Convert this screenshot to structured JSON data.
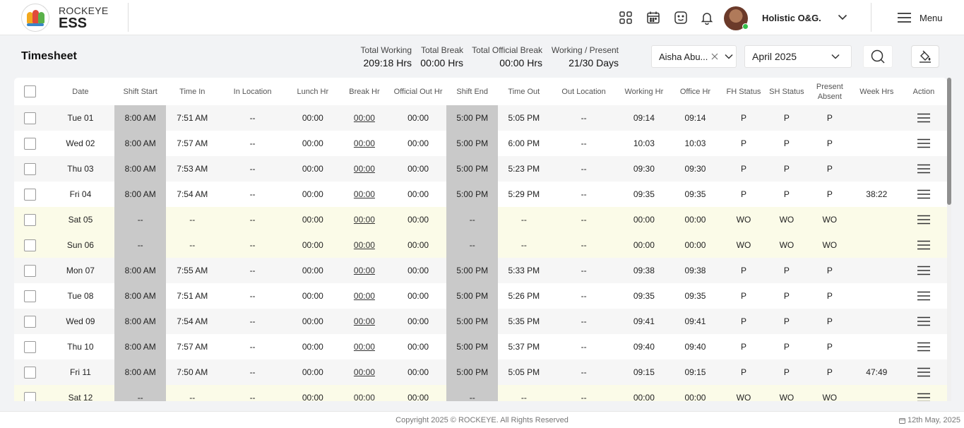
{
  "header": {
    "brand_top": "ROCKEYE",
    "brand_bottom": "ESS",
    "org_name": "Holistic O&G.",
    "menu_label": "Menu",
    "icons": [
      "apps-grid-icon",
      "calendar-icon",
      "chat-icon",
      "bell-icon"
    ]
  },
  "titlebar": {
    "title": "Timesheet",
    "stats": [
      {
        "label": "Total Working",
        "value": "209:18 Hrs"
      },
      {
        "label": "Total Break",
        "value": "00:00 Hrs"
      },
      {
        "label": "Total Official Break",
        "value": "00:00 Hrs"
      },
      {
        "label": "Working / Present",
        "value": "21/30 Days"
      }
    ],
    "employee": "Aisha Abu...",
    "month": "April 2025"
  },
  "table": {
    "headers": [
      "Date",
      "Shift Start",
      "Time In",
      "In Location",
      "Lunch Hr",
      "Break Hr",
      "Official Out Hr",
      "Shift End",
      "Time Out",
      "Out Location",
      "Working Hr",
      "Office Hr",
      "FH Status",
      "SH Status",
      "Present Absent",
      "Week Hrs",
      "Action"
    ],
    "rows": [
      {
        "date": "Tue 01",
        "shift_start": "8:00 AM",
        "time_in": "7:51 AM",
        "in_loc": "--",
        "lunch": "00:00",
        "brk": "00:00",
        "off_out": "00:00",
        "shift_end": "5:00 PM",
        "time_out": "5:05 PM",
        "out_loc": "--",
        "working": "09:14",
        "office": "09:14",
        "fh": "P",
        "sh": "P",
        "pa": "P",
        "week": "",
        "weekend": false
      },
      {
        "date": "Wed 02",
        "shift_start": "8:00 AM",
        "time_in": "7:57 AM",
        "in_loc": "--",
        "lunch": "00:00",
        "brk": "00:00",
        "off_out": "00:00",
        "shift_end": "5:00 PM",
        "time_out": "6:00 PM",
        "out_loc": "--",
        "working": "10:03",
        "office": "10:03",
        "fh": "P",
        "sh": "P",
        "pa": "P",
        "week": "",
        "weekend": false
      },
      {
        "date": "Thu 03",
        "shift_start": "8:00 AM",
        "time_in": "7:53 AM",
        "in_loc": "--",
        "lunch": "00:00",
        "brk": "00:00",
        "off_out": "00:00",
        "shift_end": "5:00 PM",
        "time_out": "5:23 PM",
        "out_loc": "--",
        "working": "09:30",
        "office": "09:30",
        "fh": "P",
        "sh": "P",
        "pa": "P",
        "week": "",
        "weekend": false
      },
      {
        "date": "Fri 04",
        "shift_start": "8:00 AM",
        "time_in": "7:54 AM",
        "in_loc": "--",
        "lunch": "00:00",
        "brk": "00:00",
        "off_out": "00:00",
        "shift_end": "5:00 PM",
        "time_out": "5:29 PM",
        "out_loc": "--",
        "working": "09:35",
        "office": "09:35",
        "fh": "P",
        "sh": "P",
        "pa": "P",
        "week": "38:22",
        "weekend": false
      },
      {
        "date": "Sat 05",
        "shift_start": "--",
        "time_in": "--",
        "in_loc": "--",
        "lunch": "00:00",
        "brk": "00:00",
        "off_out": "00:00",
        "shift_end": "--",
        "time_out": "--",
        "out_loc": "--",
        "working": "00:00",
        "office": "00:00",
        "fh": "WO",
        "sh": "WO",
        "pa": "WO",
        "week": "",
        "weekend": true
      },
      {
        "date": "Sun 06",
        "shift_start": "--",
        "time_in": "--",
        "in_loc": "--",
        "lunch": "00:00",
        "brk": "00:00",
        "off_out": "00:00",
        "shift_end": "--",
        "time_out": "--",
        "out_loc": "--",
        "working": "00:00",
        "office": "00:00",
        "fh": "WO",
        "sh": "WO",
        "pa": "WO",
        "week": "",
        "weekend": true
      },
      {
        "date": "Mon 07",
        "shift_start": "8:00 AM",
        "time_in": "7:55 AM",
        "in_loc": "--",
        "lunch": "00:00",
        "brk": "00:00",
        "off_out": "00:00",
        "shift_end": "5:00 PM",
        "time_out": "5:33 PM",
        "out_loc": "--",
        "working": "09:38",
        "office": "09:38",
        "fh": "P",
        "sh": "P",
        "pa": "P",
        "week": "",
        "weekend": false
      },
      {
        "date": "Tue 08",
        "shift_start": "8:00 AM",
        "time_in": "7:51 AM",
        "in_loc": "--",
        "lunch": "00:00",
        "brk": "00:00",
        "off_out": "00:00",
        "shift_end": "5:00 PM",
        "time_out": "5:26 PM",
        "out_loc": "--",
        "working": "09:35",
        "office": "09:35",
        "fh": "P",
        "sh": "P",
        "pa": "P",
        "week": "",
        "weekend": false
      },
      {
        "date": "Wed 09",
        "shift_start": "8:00 AM",
        "time_in": "7:54 AM",
        "in_loc": "--",
        "lunch": "00:00",
        "brk": "00:00",
        "off_out": "00:00",
        "shift_end": "5:00 PM",
        "time_out": "5:35 PM",
        "out_loc": "--",
        "working": "09:41",
        "office": "09:41",
        "fh": "P",
        "sh": "P",
        "pa": "P",
        "week": "",
        "weekend": false
      },
      {
        "date": "Thu 10",
        "shift_start": "8:00 AM",
        "time_in": "7:57 AM",
        "in_loc": "--",
        "lunch": "00:00",
        "brk": "00:00",
        "off_out": "00:00",
        "shift_end": "5:00 PM",
        "time_out": "5:37 PM",
        "out_loc": "--",
        "working": "09:40",
        "office": "09:40",
        "fh": "P",
        "sh": "P",
        "pa": "P",
        "week": "",
        "weekend": false
      },
      {
        "date": "Fri 11",
        "shift_start": "8:00 AM",
        "time_in": "7:50 AM",
        "in_loc": "--",
        "lunch": "00:00",
        "brk": "00:00",
        "off_out": "00:00",
        "shift_end": "5:00 PM",
        "time_out": "5:05 PM",
        "out_loc": "--",
        "working": "09:15",
        "office": "09:15",
        "fh": "P",
        "sh": "P",
        "pa": "P",
        "week": "47:49",
        "weekend": false
      },
      {
        "date": "Sat 12",
        "shift_start": "--",
        "time_in": "--",
        "in_loc": "--",
        "lunch": "00:00",
        "brk": "00:00",
        "off_out": "00:00",
        "shift_end": "--",
        "time_out": "--",
        "out_loc": "--",
        "working": "00:00",
        "office": "00:00",
        "fh": "WO",
        "sh": "WO",
        "pa": "WO",
        "week": "",
        "weekend": true
      }
    ]
  },
  "footer": {
    "copyright": "Copyright 2025 © ROCKEYE. All Rights Reserved",
    "date": "12th May, 2025"
  },
  "colors": {
    "shift_cell": "#c9c9c9",
    "weekend_row": "#fbfbe8",
    "status_online": "#34c04a"
  }
}
